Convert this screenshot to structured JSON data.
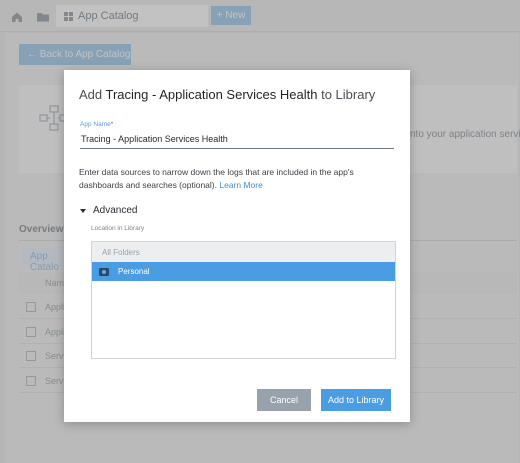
{
  "tabs": {
    "home_icon": "home-icon",
    "folder_icon": "folder-icon",
    "catalog_label": "App Catalog",
    "new_label": "+ New"
  },
  "background": {
    "back_button": "←  Back to App Catalog",
    "card_text": "nto your application service",
    "overview_tab": "Overview",
    "app_catalog_tab": "App Catalo",
    "table_header": "Name",
    "rows": [
      "Applic",
      "Applic",
      "Servic",
      "Servic"
    ]
  },
  "dialog": {
    "title_prefix": "Add ",
    "title_app": "Tracing - Application Services Health",
    "title_suffix": " to Library",
    "field_label": "App Name",
    "field_required": "*",
    "app_name_value": "Tracing - Application Services Health",
    "description": "Enter data sources to narrow down the logs that are included in the app's dashboards and searches (optional).",
    "learn_more": "Learn More",
    "advanced_label": "Advanced",
    "location_label": "Location in Library",
    "tree": {
      "root": "All Folders",
      "selected": "Personal"
    },
    "cancel_label": "Cancel",
    "add_label": "Add to Library"
  },
  "colors": {
    "accent": "#4a9de3",
    "cancel": "#97a2ad"
  }
}
